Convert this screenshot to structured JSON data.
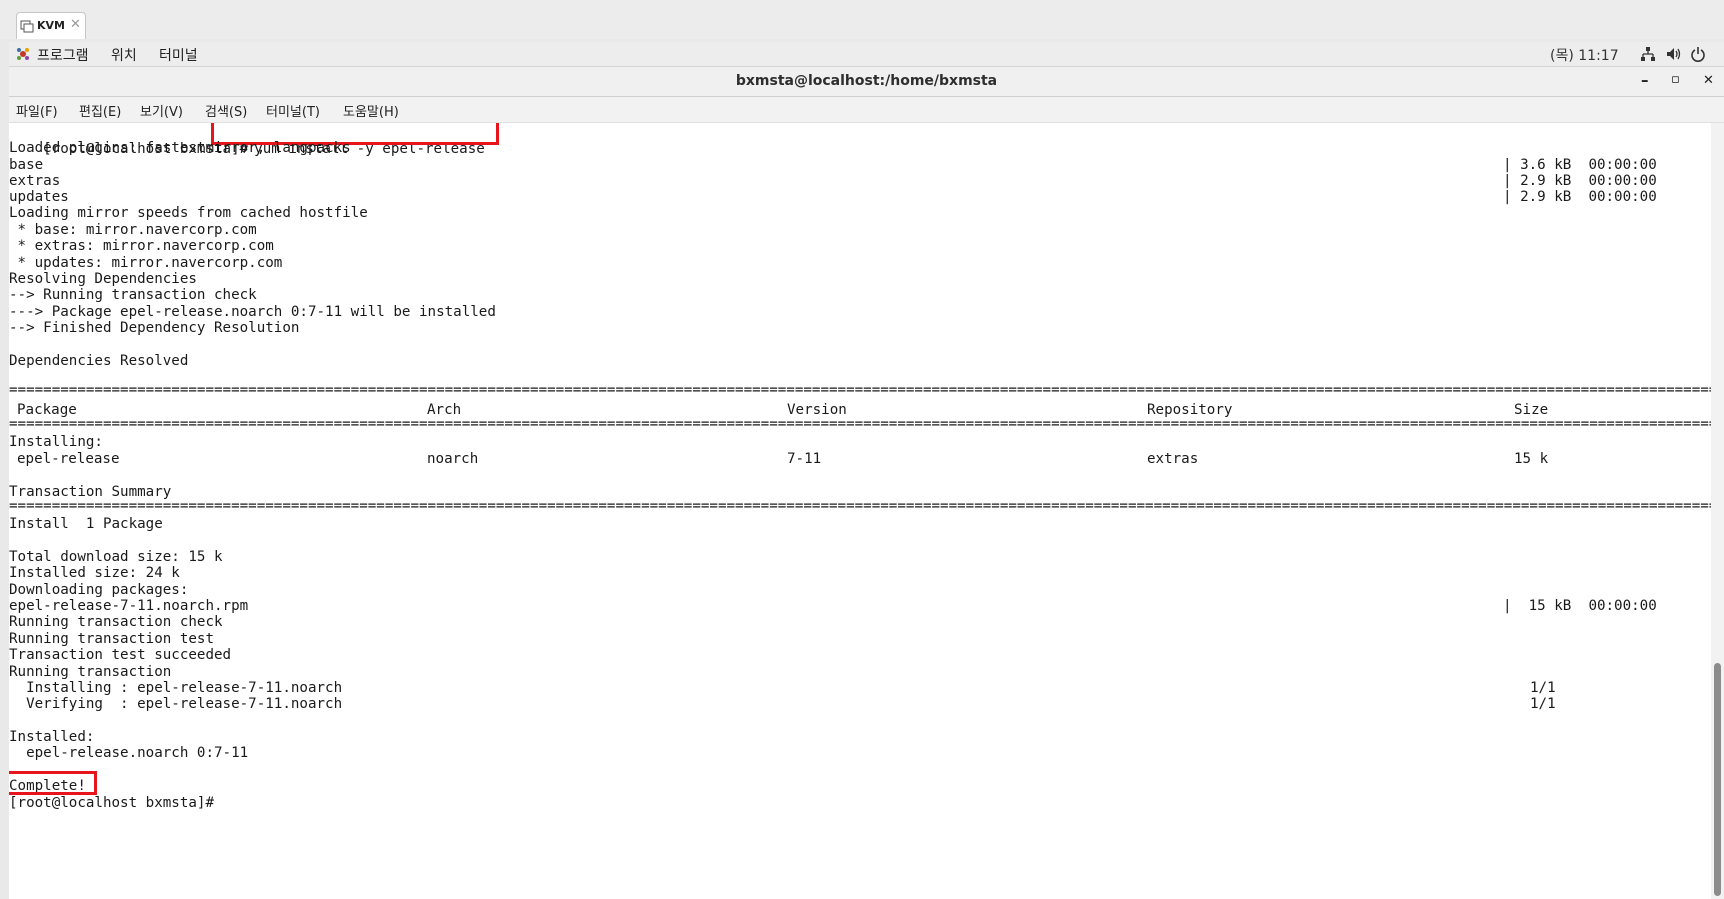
{
  "tab": {
    "title": "KVM",
    "close": "✕",
    "icon": "vm-icon"
  },
  "topbar": {
    "menus": [
      "프로그램",
      "위치",
      "터미널"
    ],
    "clock": "(목) 11:17",
    "icons": [
      "network-icon",
      "volume-icon",
      "power-icon"
    ]
  },
  "window": {
    "title": "bxmsta@localhost:/home/bxmsta",
    "controls": {
      "minimize": "–",
      "maximize": "▫",
      "close": "✕"
    }
  },
  "menubar": [
    "파일(F)",
    "편집(E)",
    "보기(V)",
    "검색(S)",
    "터미널(T)",
    "도움말(H)"
  ],
  "terminal": {
    "prompt": "[root@localhost bxmsta]#",
    "command": "yum install -y epel-release",
    "lines": [
      "Loaded plugins: fastestmirror, langpacks",
      "base",
      "extras",
      "updates",
      "Loading mirror speeds from cached hostfile",
      " * base: mirror.navercorp.com",
      " * extras: mirror.navercorp.com",
      " * updates: mirror.navercorp.com",
      "Resolving Dependencies",
      "--> Running transaction check",
      "---> Package epel-release.noarch 0:7-11 will be installed",
      "--> Finished Dependency Resolution",
      "Dependencies Resolved"
    ],
    "repo_stats": [
      {
        "size": "3.6 kB",
        "time": "00:00:00"
      },
      {
        "size": "2.9 kB",
        "time": "00:00:00"
      },
      {
        "size": "2.9 kB",
        "time": "00:00:00"
      }
    ],
    "table": {
      "headers": [
        "Package",
        "Arch",
        "Version",
        "Repository",
        "Size"
      ],
      "section": "Installing:",
      "rows": [
        {
          "package": "epel-release",
          "arch": "noarch",
          "version": "7-11",
          "repository": "extras",
          "size": "15 k"
        }
      ]
    },
    "summary_title": "Transaction Summary",
    "install_count": "Install  1 Package",
    "after_lines": [
      "Total download size: 15 k",
      "Installed size: 24 k",
      "Downloading packages:",
      "epel-release-7-11.noarch.rpm",
      "Running transaction check",
      "Running transaction test",
      "Transaction test succeeded",
      "Running transaction",
      "  Installing : epel-release-7-11.noarch",
      "  Verifying  : epel-release-7-11.noarch"
    ],
    "download_stat": {
      "size": "15 kB",
      "time": "00:00:00"
    },
    "progress": [
      "1/1",
      "1/1"
    ],
    "installed_title": "Installed:",
    "installed_pkg": "  epel-release.noarch 0:7-11",
    "complete": "Complete!",
    "final_prompt": "[root@localhost bxmsta]#"
  },
  "colors": {
    "highlight": "#e8141c",
    "terminal_bg": "#ffffff",
    "text": "#1a1a1a"
  }
}
